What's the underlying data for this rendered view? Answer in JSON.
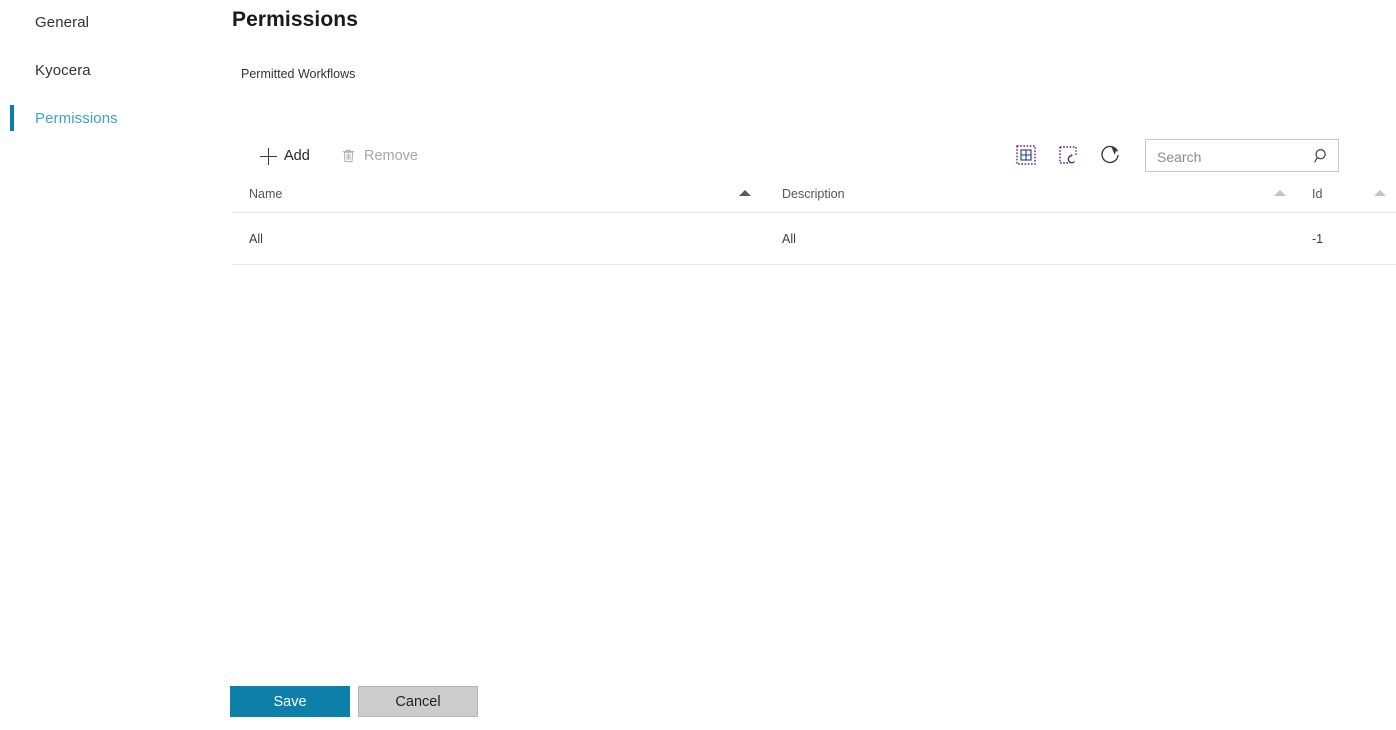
{
  "sidebar": {
    "items": [
      {
        "label": "General",
        "selected": false,
        "name": "sidebar-item-general"
      },
      {
        "label": "Kyocera",
        "selected": false,
        "name": "sidebar-item-kyocera"
      },
      {
        "label": "Permissions",
        "selected": true,
        "name": "sidebar-item-permissions"
      }
    ]
  },
  "header": {
    "title": "Permissions"
  },
  "main": {
    "section_label": "Permitted Workflows"
  },
  "toolbar": {
    "add_label": "Add",
    "remove_label": "Remove",
    "add_icon": "plus-icon",
    "remove_icon": "trash-icon",
    "columns_icon": "column-chooser-icon",
    "reset_icon": "reset-layout-icon",
    "refresh_icon": "refresh-icon"
  },
  "search": {
    "placeholder": "Search",
    "value": "",
    "icon": "search-icon"
  },
  "grid": {
    "columns": [
      {
        "key": "name",
        "label": "Name",
        "sorted": true,
        "sort_direction": "asc"
      },
      {
        "key": "description",
        "label": "Description",
        "sorted": false,
        "sort_direction": "asc"
      },
      {
        "key": "id",
        "label": "Id",
        "sorted": false,
        "sort_direction": "asc"
      }
    ],
    "rows": [
      {
        "name": "All",
        "description": "All",
        "id": "-1"
      }
    ]
  },
  "footer": {
    "save_label": "Save",
    "cancel_label": "Cancel"
  },
  "colors": {
    "accent": "#0c80a8",
    "selected_nav_text": "#3fa0cc",
    "save_button": "#0c80a8",
    "cancel_button": "#cccccc",
    "border": "#e6e6e6"
  }
}
